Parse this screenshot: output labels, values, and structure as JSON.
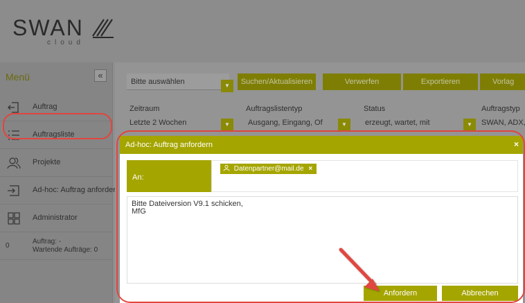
{
  "brand": {
    "name": "SWAN",
    "sub": "cloud"
  },
  "sidebar": {
    "title": "Menü",
    "collapse": "«",
    "items": [
      {
        "label": "Auftrag",
        "icon": "inbox-arrow-icon"
      },
      {
        "label": "Auftragsliste",
        "icon": "list-icon"
      },
      {
        "label": "Projekte",
        "icon": "users-icon"
      },
      {
        "label": "Ad-hoc: Auftrag anfordern",
        "icon": "request-arrow-icon"
      },
      {
        "label": "Administrator",
        "icon": "grid-icon"
      }
    ],
    "status": {
      "count": "0",
      "line1": "Auftrag: -",
      "line2": "Wartende Aufträge: 0"
    }
  },
  "toolbar": {
    "select_value": "Bitte auswählen",
    "buttons": [
      "Suchen/Aktualisieren",
      "Verwerfen",
      "Exportieren",
      "Vorlag"
    ]
  },
  "filters": [
    {
      "label": "Zeitraum",
      "value": "Letzte 2 Wochen"
    },
    {
      "label": "Auftragslistentyp",
      "value": "Ausgang, Eingang, Of"
    },
    {
      "label": "Status",
      "value": "erzeugt, wartet, mit"
    },
    {
      "label": "Auftragstyp",
      "value": "SWAN, ADX,"
    }
  ],
  "dialog": {
    "title": "Ad-hoc: Auftrag anfordern",
    "close": "×",
    "to_label": "An:",
    "recipient": "Datenpartner@mail.de",
    "chip_remove": "×",
    "message_lines": [
      "Bitte Dateiversion V9.1 schicken,",
      "MfG"
    ],
    "submit_label": "Anfordern",
    "cancel_label": "Abbrechen"
  },
  "colors": {
    "accent": "#a5a500",
    "annotation": "#e0463f"
  }
}
